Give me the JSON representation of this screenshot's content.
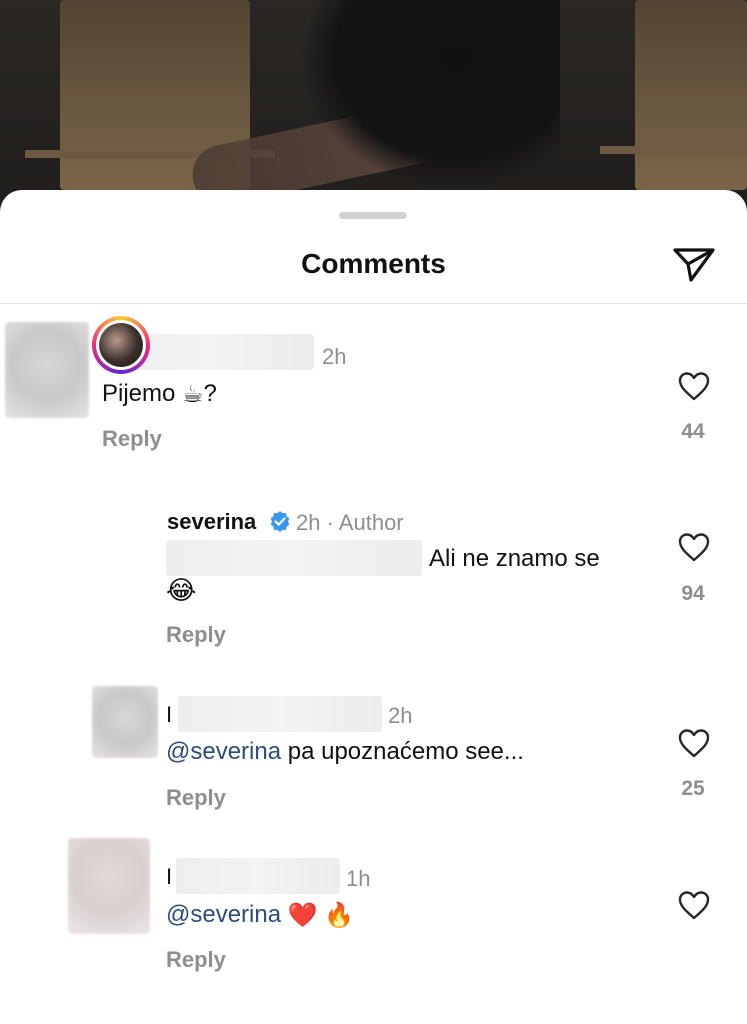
{
  "header": {
    "title": "Comments"
  },
  "comments": [
    {
      "time": "2h",
      "text": "Pijemo",
      "emoji": "☕",
      "suffix": "?",
      "reply": "Reply",
      "likes": "44"
    },
    {
      "username": "severina",
      "time": "2h · Author",
      "text": "Ali ne znamo se",
      "emoji": "😂",
      "reply": "Reply",
      "likes": "94"
    },
    {
      "name_initial": "I",
      "time": "2h",
      "mention": "@severina",
      "text": "pa upoznaćemo see...",
      "reply": "Reply",
      "likes": "25"
    },
    {
      "name_initial": "I",
      "time": "1h",
      "mention": "@severina",
      "emoji1": "❤️",
      "emoji2": "🔥",
      "reply": "Reply"
    }
  ],
  "colors": {
    "mention": "#2c4d7a",
    "muted": "#8e8e8e",
    "verified": "#3897f0"
  },
  "icons": [
    "send-icon",
    "heart-icon",
    "verified-badge-icon"
  ]
}
